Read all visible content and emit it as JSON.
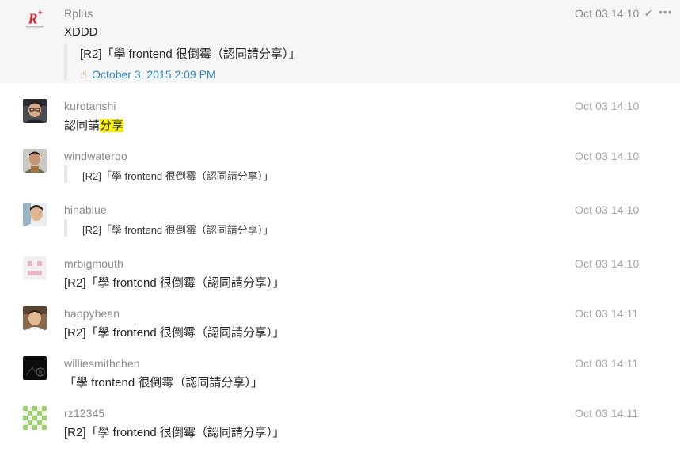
{
  "messages": [
    {
      "user": "Rplus",
      "time": "Oct 03 14:10",
      "text": "XDDD",
      "quote": {
        "text": "[R2]「學 frontend 很倒霉（認同請分享）」",
        "link": "October 3, 2015 2:09 PM",
        "link_icon": "pointing-finger-icon"
      },
      "avatar_icon": "rplus-logo-icon",
      "status_icon": "check-icon",
      "menu_icon": "more-options-icon"
    },
    {
      "user": "kurotanshi",
      "time": "Oct 03 14:10",
      "text_before": "認同請",
      "text_highlight": "分享",
      "highlight_color": "#fdf600"
    },
    {
      "user": "windwaterbo",
      "time": "Oct 03 14:10",
      "quote": {
        "text": "[R2]「學 frontend 很倒霉（認同請分享）」"
      }
    },
    {
      "user": "hinablue",
      "time": "Oct 03 14:10",
      "quote": {
        "text": "[R2]「學 frontend 很倒霉（認同請分享）」"
      }
    },
    {
      "user": "mrbigmouth",
      "time": "Oct 03 14:10",
      "text": "[R2]「學 frontend 很倒霉（認同請分享）」"
    },
    {
      "user": "happybean",
      "time": "Oct 03 14:11",
      "text": "[R2]「學 frontend 很倒霉（認同請分享）」"
    },
    {
      "user": "williesmithchen",
      "time": "Oct 03 14:11",
      "text": "「學 frontend 很倒霉（認同請分享）」"
    },
    {
      "user": "rz12345",
      "time": "Oct 03 14:11",
      "text": "[R2]「學 frontend 很倒霉（認同請分享）」"
    }
  ],
  "colors": {
    "link": "#2e8bc9",
    "highlight": "#fdf600",
    "row_selected": "#f6f6f6",
    "rplus_red": "#d6262c"
  }
}
